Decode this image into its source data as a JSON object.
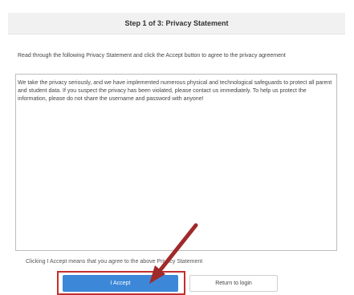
{
  "header": {
    "step_title": "Step 1 of 3: Privacy Statement"
  },
  "instructions": "Read through the following Privacy Statement and click the Accept button to agree to the privacy agreement",
  "statement": {
    "text": "We take the privacy seriously, and we have implemented numerous physical and technological safeguards to protect all parent and student data. If you suspect the privacy has been violated, please contact us immediately. To help us protect the information, please do not share the username and password with anyone!"
  },
  "accept_note": "Clicking I Accept means that you agree to the above Privacy Statement",
  "buttons": {
    "accept_label": "I Accept",
    "return_label": "Return to login"
  },
  "colors": {
    "accent": "#3d87d9",
    "highlight": "#c42e2e",
    "annotation_arrow": "#a02a2a"
  }
}
